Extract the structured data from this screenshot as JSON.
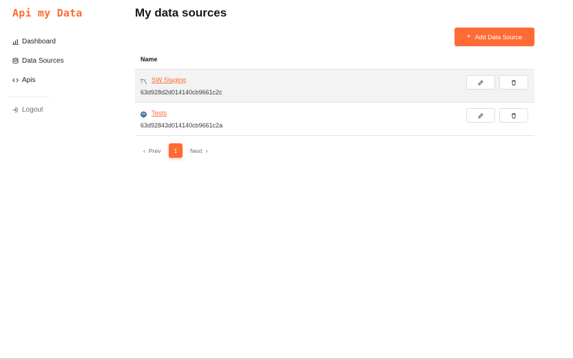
{
  "app": {
    "logo": "Api my Data",
    "brand_color": "#ff6b35"
  },
  "sidebar": {
    "items": [
      {
        "label": "Dashboard",
        "icon": "bar-chart-icon"
      },
      {
        "label": "Data Sources",
        "icon": "database-icon"
      },
      {
        "label": "Apis",
        "icon": "code-icon"
      }
    ],
    "logout": {
      "label": "Logout",
      "icon": "logout-icon"
    }
  },
  "main": {
    "title": "My data sources",
    "add_button": {
      "label": "Add Data Source",
      "icon": "plus-icon"
    },
    "table": {
      "column_name": "Name",
      "rows": [
        {
          "name": "SW Staging",
          "id": "63d928d2d014140cb9661c2c",
          "type_icon": "mysql-icon",
          "edit_icon": "pencil-icon",
          "delete_icon": "trash-icon"
        },
        {
          "name": "Tests",
          "id": "63d92843d014140cb9661c2a",
          "type_icon": "postgresql-icon",
          "edit_icon": "pencil-icon",
          "delete_icon": "trash-icon"
        }
      ]
    },
    "pagination": {
      "prev_label": "Prev",
      "current_page": "1",
      "next_label": "Next"
    }
  }
}
